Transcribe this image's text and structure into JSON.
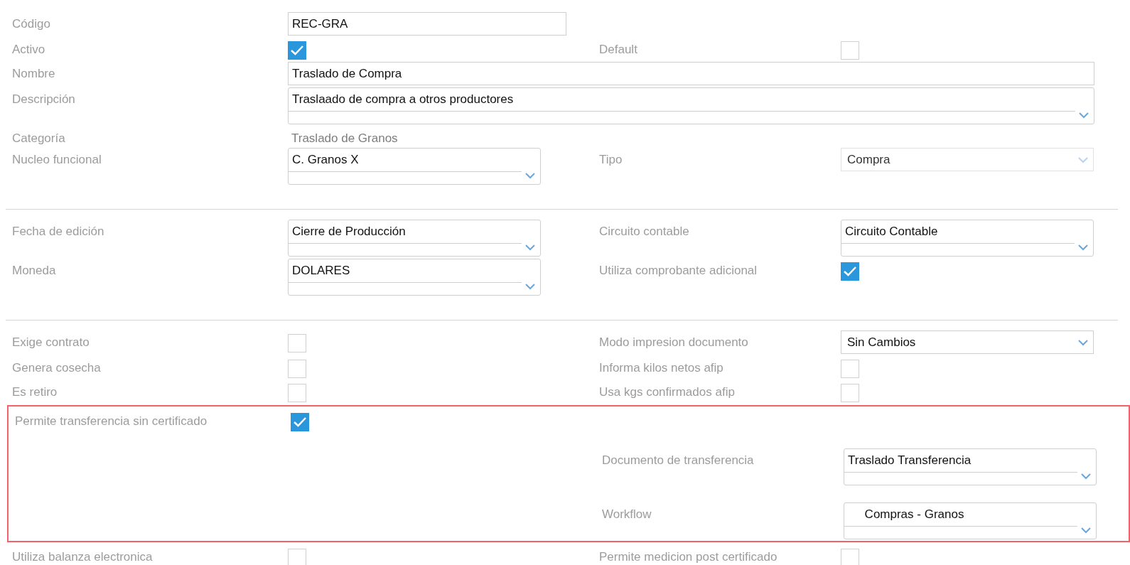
{
  "sections": [
    {
      "divider": false,
      "highlighted": false,
      "rows": [
        {
          "left": {
            "label": "Código",
            "kind": "input",
            "value": "REC-GRA"
          }
        },
        {
          "left": {
            "label": "Activo",
            "kind": "checkbox",
            "checked": true
          },
          "right": {
            "label": "Default",
            "kind": "checkbox",
            "checked": false
          }
        },
        {
          "left": {
            "label": "Nombre",
            "kind": "input",
            "value": "Traslado de Compra",
            "wide": true
          }
        },
        {
          "left": {
            "label": "Descripción",
            "kind": "combo",
            "value": "Traslaado de compra a otros productores",
            "wide": true
          }
        },
        {
          "left": {
            "label": "Categoría",
            "kind": "static",
            "value": "Traslado de Granos"
          }
        },
        {
          "left": {
            "label": "Nucleo funcional",
            "kind": "combo",
            "value": "C. Granos X"
          },
          "right": {
            "label": "Tipo",
            "kind": "dropdown",
            "value": "Compra",
            "disabled": true
          }
        }
      ]
    },
    {
      "divider": true,
      "highlighted": false,
      "rows": [
        {
          "left": {
            "label": "Fecha de edición",
            "kind": "combo",
            "value": "Cierre de Producción"
          },
          "right": {
            "label": "Circuito contable",
            "kind": "combo",
            "value": "Circuito Contable"
          }
        },
        {
          "left": {
            "label": "Moneda",
            "kind": "combo",
            "value": "DOLARES"
          },
          "right": {
            "label": "Utiliza comprobante adicional",
            "kind": "checkbox",
            "checked": true
          }
        }
      ]
    },
    {
      "divider": true,
      "highlighted": false,
      "rows": [
        {
          "left": {
            "label": "Exige contrato",
            "kind": "checkbox",
            "checked": false
          },
          "right": {
            "label": "Modo impresion documento",
            "kind": "dropdown",
            "value": "Sin Cambios",
            "disabled": false
          }
        },
        {
          "left": {
            "label": "Genera cosecha",
            "kind": "checkbox",
            "checked": false
          },
          "right": {
            "label": "Informa kilos netos afip",
            "kind": "checkbox",
            "checked": false
          }
        },
        {
          "left": {
            "label": "Es retiro",
            "kind": "checkbox",
            "checked": false
          },
          "right": {
            "label": "Usa kgs confirmados afip",
            "kind": "checkbox",
            "checked": false
          }
        }
      ]
    },
    {
      "divider": false,
      "highlighted": true,
      "rows": [
        {
          "left": {
            "label": "Permite transferencia sin certificado",
            "kind": "checkbox",
            "checked": true
          }
        },
        {
          "right": {
            "label": "Documento de transferencia",
            "kind": "combo",
            "value": "Traslado Transferencia"
          }
        },
        {
          "right": {
            "label": "Workflow",
            "kind": "combo",
            "value": "     Compras - Granos"
          }
        }
      ]
    },
    {
      "divider": false,
      "highlighted": false,
      "rows": [
        {
          "left": {
            "label": "Utiliza balanza electronica",
            "kind": "checkbox",
            "checked": false
          },
          "right": {
            "label": "Permite medicion post certificado",
            "kind": "checkbox",
            "checked": false
          }
        }
      ]
    }
  ]
}
